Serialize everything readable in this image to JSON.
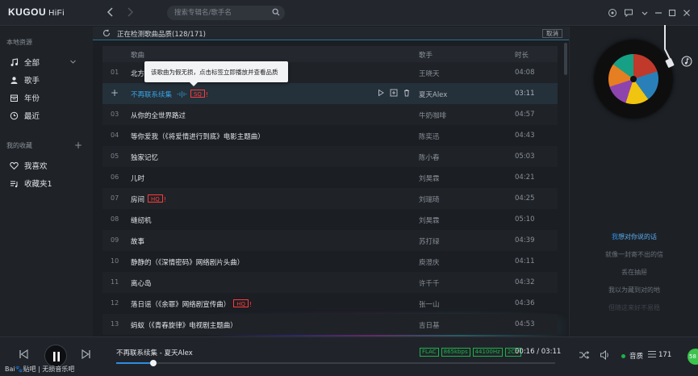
{
  "app": {
    "logo": "KUGOU",
    "logo_suffix": "HiFi"
  },
  "search": {
    "placeholder": "搜索专辑名/歌手名"
  },
  "sidebar": {
    "local_title": "本地资源",
    "local_items": [
      {
        "label": "全部",
        "icon": "music-note-icon"
      },
      {
        "label": "歌手",
        "icon": "person-icon"
      },
      {
        "label": "年份",
        "icon": "calendar-icon"
      },
      {
        "label": "最近",
        "icon": "clock-icon"
      }
    ],
    "fav_title": "我的收藏",
    "fav_add": "+",
    "fav_items": [
      {
        "label": "我喜欢",
        "icon": "heart-icon"
      },
      {
        "label": "收藏夹1",
        "icon": "playlist-icon"
      }
    ]
  },
  "scan": {
    "text": "正在检测歌曲品质(128/171)",
    "cancel": "取消"
  },
  "table": {
    "headers": {
      "title": "歌曲",
      "artist": "歌手",
      "duration": "时长"
    },
    "tooltip": "该歌曲为假无损，点击标签立即播放并查看品质",
    "rows": [
      {
        "num": "01",
        "title": "北方",
        "artist": "王晓天",
        "duration": "04:08"
      },
      {
        "num": "+",
        "title": "不再联系续集",
        "artist": "夏天Alex",
        "duration": "03:11",
        "active": true,
        "badge": "SQ",
        "waves": "-ı|ı-"
      },
      {
        "num": "03",
        "title": "从你的全世界路过",
        "artist": "牛奶咖啡",
        "duration": "04:57"
      },
      {
        "num": "04",
        "title": "等你爱我（《将爱情进行到底》电影主题曲）",
        "artist": "陈奕迅",
        "duration": "04:43"
      },
      {
        "num": "05",
        "title": "独家记忆",
        "artist": "陈小春",
        "duration": "05:03"
      },
      {
        "num": "06",
        "title": "儿时",
        "artist": "刘昊霖",
        "duration": "04:21"
      },
      {
        "num": "07",
        "title": "房间",
        "artist": "刘瑞琦",
        "duration": "04:25",
        "hq": "HQ"
      },
      {
        "num": "08",
        "title": "缝纫机",
        "artist": "刘昊霖",
        "duration": "05:10"
      },
      {
        "num": "09",
        "title": "故事",
        "artist": "苏打绿",
        "duration": "04:39"
      },
      {
        "num": "10",
        "title": "静静的（《深情密码》网络剧片头曲）",
        "artist": "庾澄庆",
        "duration": "04:11"
      },
      {
        "num": "11",
        "title": "离心岛",
        "artist": "许千千",
        "duration": "04:32"
      },
      {
        "num": "12",
        "title": "落日谣（《余罪》网络剧宣传曲）",
        "artist": "张一山",
        "duration": "04:36",
        "hq": "HQ"
      },
      {
        "num": "13",
        "title": "蚂蚁（《青春旋律》电视剧主题曲）",
        "artist": "吉日基",
        "duration": "04:53"
      }
    ]
  },
  "lyrics": {
    "current_lead": "我",
    "current_rest": "想对你说的话",
    "lines": [
      "就像一封寄不出的信",
      "丢在抽屉",
      "我以为藏到对的地",
      "但随这来好不易稳"
    ]
  },
  "player": {
    "now_playing": "不再联系续集 - 夏天Alex",
    "tags": [
      "FLAC",
      "865kbps",
      "44100Hz",
      "2Ch"
    ],
    "time": "00:16 / 03:11",
    "progress": 0.084,
    "quality_label": "音质",
    "playlist_count": "171",
    "watermark": "Bai🐾贴吧 | 无损音乐吧",
    "ball_text": "58"
  },
  "colors": {
    "accent": "#2d8ce0",
    "sq_badge": "#ff3b3b",
    "quality_green": "#1fb14a"
  }
}
